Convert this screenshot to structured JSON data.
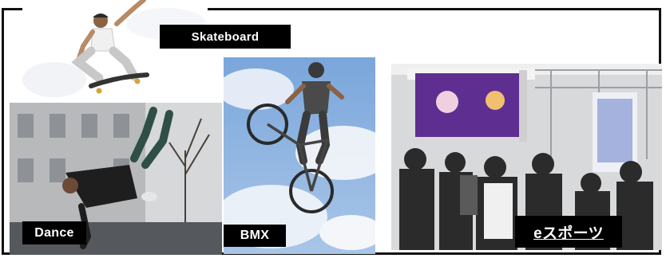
{
  "panels": {
    "skateboard": {
      "label": "Skateboard"
    },
    "dance": {
      "label": "Dance"
    },
    "bmx": {
      "label": "BMX"
    },
    "esports": {
      "label": "eスポーツ"
    }
  },
  "colors": {
    "frame": "#111111",
    "label_bg": "#000000",
    "label_text": "#ffffff",
    "sky": "#8fb4e0",
    "cloud": "#eef2f8",
    "esports_screen": "#7a3ab0"
  }
}
